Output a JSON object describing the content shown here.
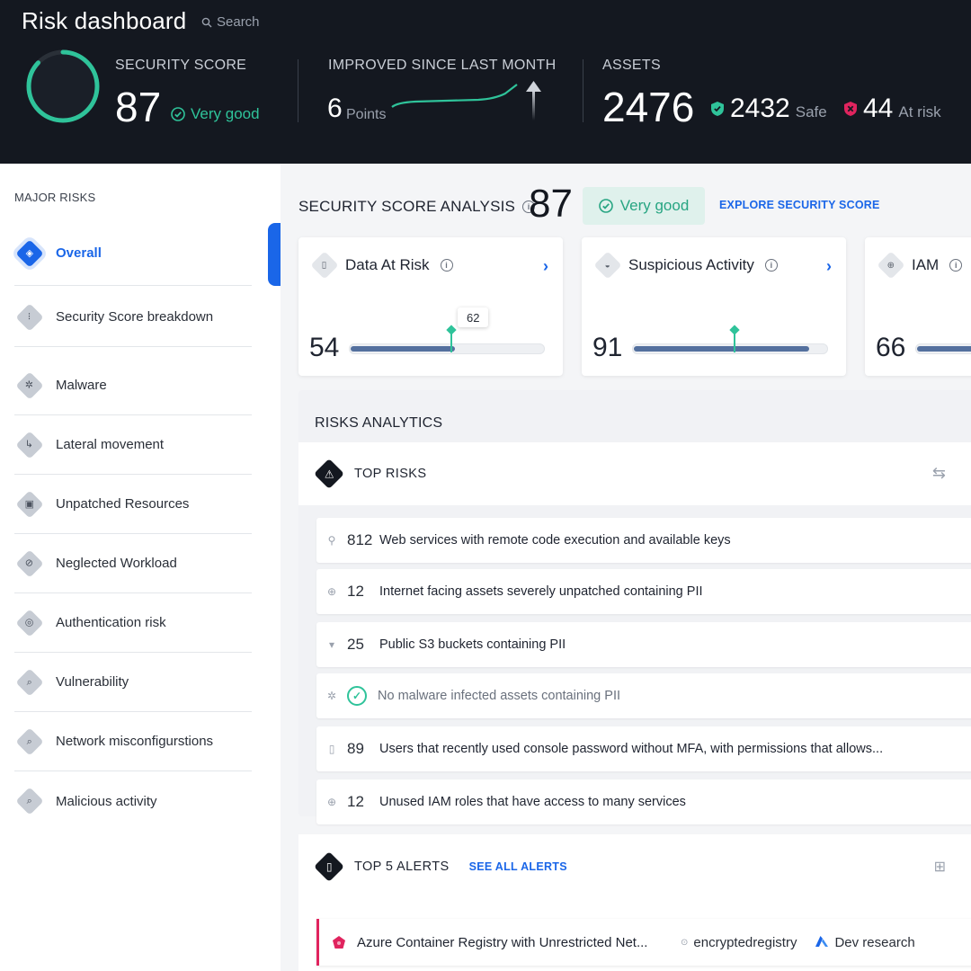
{
  "header": {
    "title": "Risk dashboard",
    "search_placeholder": "Search",
    "security_score": {
      "label": "SECURITY SCORE",
      "value": "87",
      "status": "Very good",
      "ring_fraction": 0.87
    },
    "improved": {
      "label": "IMPROVED SINCE LAST MONTH",
      "value": "6",
      "unit": "Points"
    },
    "assets": {
      "label": "ASSETS",
      "total": "2476",
      "safe_count": "2432",
      "safe_label": "Safe",
      "risk_count": "44",
      "risk_label": "At risk"
    }
  },
  "sidebar": {
    "title": "MAJOR RISKS",
    "items": [
      {
        "label": "Overall",
        "icon": "overall-icon",
        "glyph": "◈",
        "active": true
      },
      {
        "label": "Security Score breakdown",
        "icon": "score-breakdown-icon",
        "glyph": "⁝"
      },
      {
        "label": "Malware",
        "icon": "bug-icon",
        "glyph": "✲"
      },
      {
        "label": "Lateral movement",
        "icon": "lateral-movement-icon",
        "glyph": "↳"
      },
      {
        "label": "Unpatched Resources",
        "icon": "unpatched-icon",
        "glyph": "▣"
      },
      {
        "label": "Neglected Workload",
        "icon": "neglected-icon",
        "glyph": "⊘"
      },
      {
        "label": "Authentication risk",
        "icon": "fingerprint-icon",
        "glyph": "◎"
      },
      {
        "label": "Vulnerability",
        "icon": "vulnerability-icon",
        "glyph": "⌕"
      },
      {
        "label": "Network misconfigurstions",
        "icon": "network-icon",
        "glyph": "⌕"
      },
      {
        "label": "Malicious activity",
        "icon": "malicious-icon",
        "glyph": "⌕"
      }
    ]
  },
  "analysis": {
    "title": "SECURITY SCORE ANALYSIS",
    "score": "87",
    "status": "Very good",
    "explore_label": "EXPLORE SECURITY SCORE",
    "cards": [
      {
        "title": "Data At Risk",
        "icon": "document-icon",
        "glyph": "▯",
        "value": "54",
        "fill_pct": 54,
        "marker_pct": 52,
        "marker_label": "62",
        "show_chevron": true
      },
      {
        "title": "Suspicious Activity",
        "icon": "spy-icon",
        "glyph": "◒",
        "value": "91",
        "fill_pct": 91,
        "marker_pct": 52,
        "marker_label": "",
        "show_chevron": true
      },
      {
        "title": "IAM",
        "icon": "iam-icon",
        "glyph": "⊕",
        "value": "66",
        "fill_pct": 66,
        "marker_pct": 0,
        "marker_label": "",
        "show_chevron": false
      }
    ]
  },
  "risks_analytics": {
    "title": "RISKS ANALYTICS",
    "top_risks_label": "TOP RISKS",
    "rows": [
      {
        "icon": "key-icon",
        "glyph": "⚲",
        "count": "812",
        "text": "Web services with remote code execution and available keys"
      },
      {
        "icon": "globe-icon",
        "glyph": "⊕",
        "count": "12",
        "text": "Internet facing assets severely unpatched containing PII"
      },
      {
        "icon": "bucket-icon",
        "glyph": "▾",
        "count": "25",
        "text": "Public S3 buckets containing PII"
      },
      {
        "icon": "bug-icon",
        "glyph": "✲",
        "count": "",
        "text": "No malware infected assets containing PII",
        "ok": true
      },
      {
        "icon": "document-icon",
        "glyph": "▯",
        "count": "89",
        "text": "Users that recently used console password without MFA, with permissions that allows..."
      },
      {
        "icon": "iam-icon",
        "glyph": "⊕",
        "count": "12",
        "text": "Unused IAM roles that have access to many services"
      }
    ]
  },
  "alerts": {
    "title": "TOP 5 ALERTS",
    "see_all_label": "SEE ALL ALERTS",
    "rows": [
      {
        "title": "Azure Container Registry with Unrestricted Net...",
        "resource": "encryptedregistry",
        "account": "Dev research"
      }
    ]
  },
  "colors": {
    "accent": "#1a66e8",
    "good": "#2fc39a",
    "danger": "#e0245e",
    "header_bg": "#141820",
    "bar": "#54709e"
  }
}
